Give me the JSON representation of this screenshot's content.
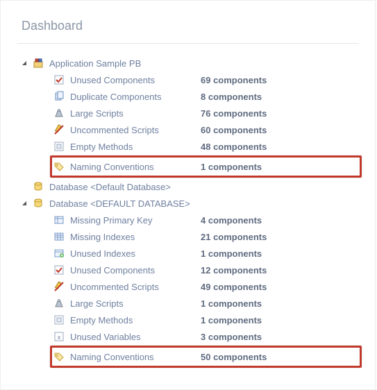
{
  "title": "Dashboard",
  "groups": [
    {
      "label": "Application Sample PB",
      "icon": "app-icon",
      "expanded": true,
      "items": [
        {
          "icon": "unused-components-icon",
          "label": "Unused Components",
          "value": "69 components",
          "highlight": false
        },
        {
          "icon": "duplicate-components-icon",
          "label": "Duplicate Components",
          "value": "8 components",
          "highlight": false
        },
        {
          "icon": "large-scripts-icon",
          "label": "Large Scripts",
          "value": "76 components",
          "highlight": false
        },
        {
          "icon": "uncommented-scripts-icon",
          "label": "Uncommented Scripts",
          "value": "60 components",
          "highlight": false
        },
        {
          "icon": "empty-methods-icon",
          "label": "Empty Methods",
          "value": "48 components",
          "highlight": false
        },
        {
          "icon": "tag-icon",
          "label": "Naming Conventions",
          "value": "1 components",
          "highlight": true
        }
      ]
    },
    {
      "label": "Database <Default Database>",
      "icon": "db-icon",
      "expanded": false,
      "items": []
    },
    {
      "label": "Database <DEFAULT DATABASE>",
      "icon": "db-icon",
      "expanded": true,
      "items": [
        {
          "icon": "primary-key-icon",
          "label": "Missing Primary Key",
          "value": "4 components",
          "highlight": false
        },
        {
          "icon": "missing-indexes-icon",
          "label": "Missing Indexes",
          "value": "21 components",
          "highlight": false
        },
        {
          "icon": "unused-indexes-icon",
          "label": "Unused Indexes",
          "value": "1 components",
          "highlight": false
        },
        {
          "icon": "unused-components-icon",
          "label": "Unused Components",
          "value": "12 components",
          "highlight": false
        },
        {
          "icon": "uncommented-scripts-icon",
          "label": "Uncommented Scripts",
          "value": "49 components",
          "highlight": false
        },
        {
          "icon": "large-scripts-icon",
          "label": "Large Scripts",
          "value": "1 components",
          "highlight": false
        },
        {
          "icon": "empty-methods-icon",
          "label": "Empty Methods",
          "value": "1 components",
          "highlight": false
        },
        {
          "icon": "unused-variables-icon",
          "label": "Unused Variables",
          "value": "3 components",
          "highlight": false
        },
        {
          "icon": "tag-icon",
          "label": "Naming Conventions",
          "value": "50 components",
          "highlight": true
        }
      ]
    }
  ]
}
